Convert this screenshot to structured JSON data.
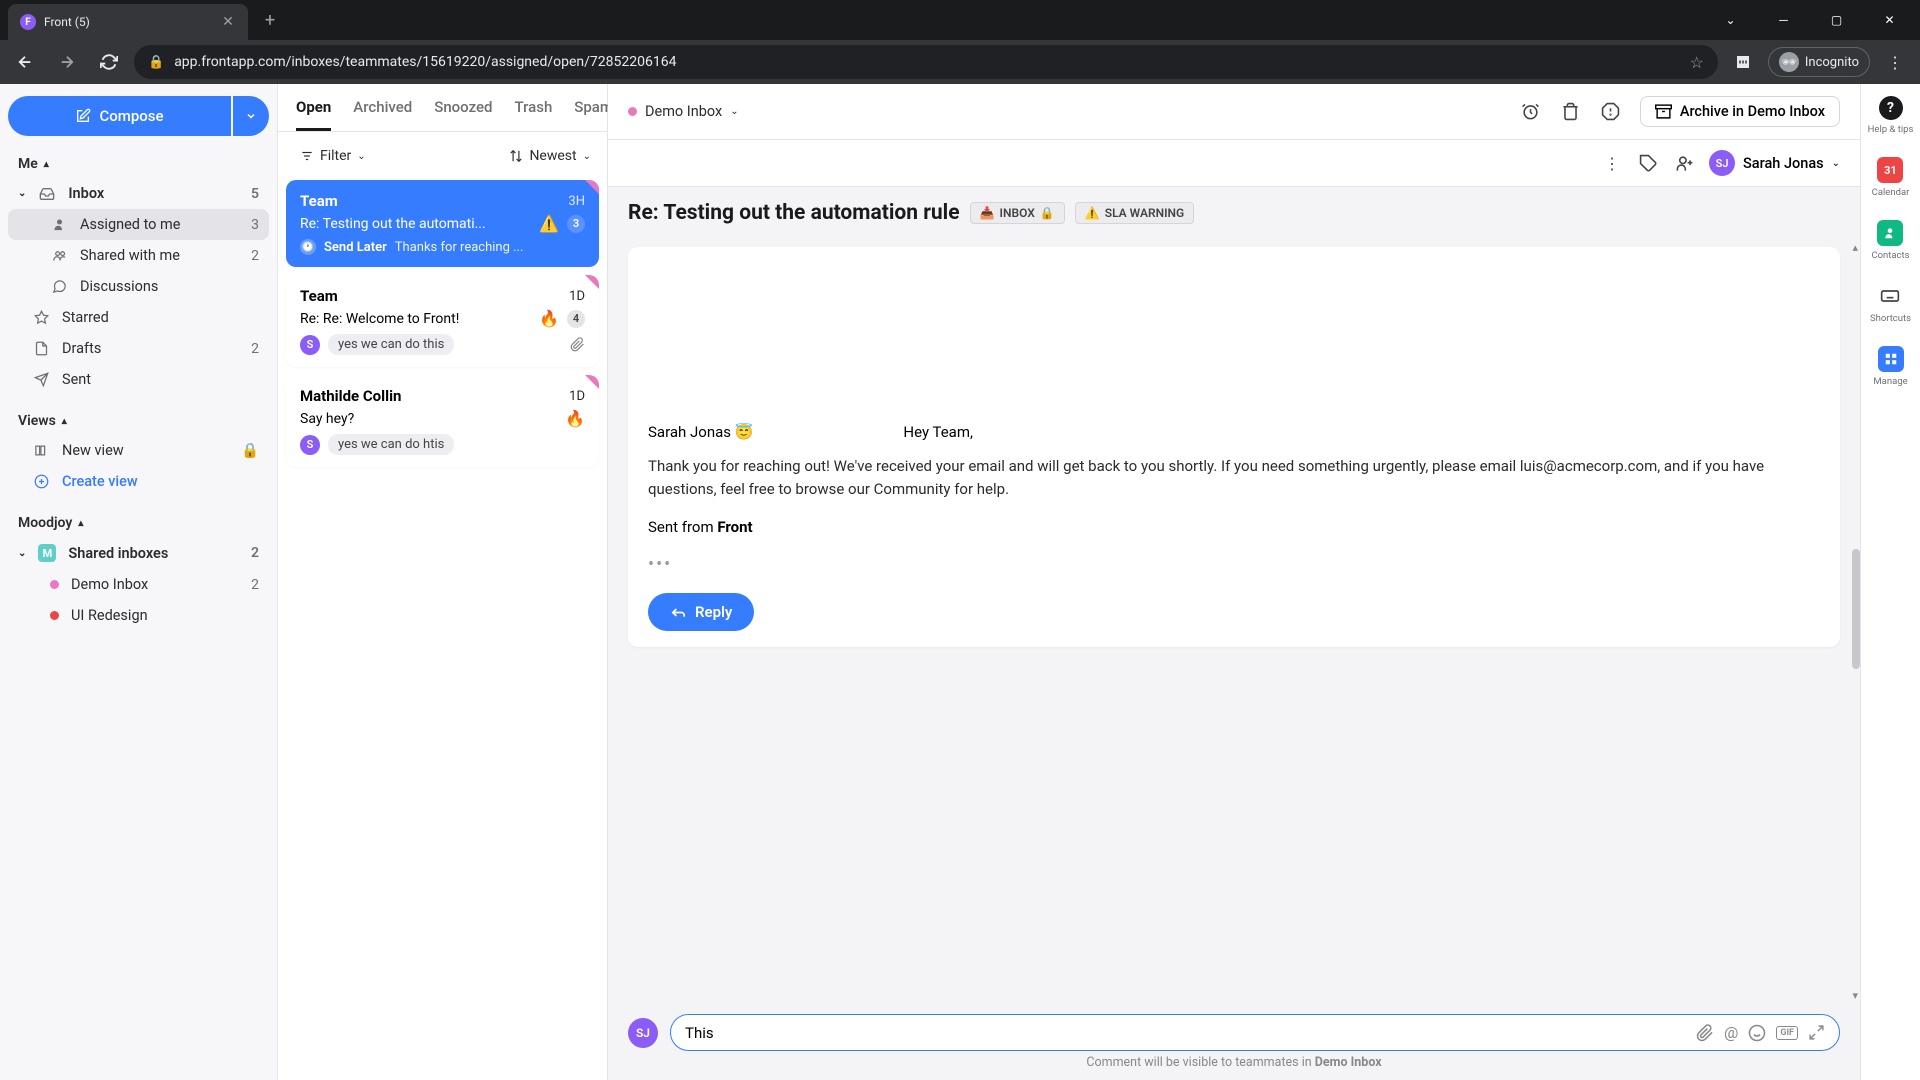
{
  "browser": {
    "tab_title": "Front (5)",
    "url": "app.frontapp.com/inboxes/teammates/15619220/assigned/open/72852206164",
    "incognito_label": "Incognito"
  },
  "sidebar": {
    "compose_label": "Compose",
    "sections": {
      "me": {
        "title": "Me"
      },
      "views": {
        "title": "Views"
      },
      "moodjoy": {
        "title": "Moodjoy"
      }
    },
    "inbox": {
      "label": "Inbox",
      "count": "5"
    },
    "assigned": {
      "label": "Assigned to me",
      "count": "3"
    },
    "shared_with_me": {
      "label": "Shared with me",
      "count": "2"
    },
    "discussions": {
      "label": "Discussions"
    },
    "starred": {
      "label": "Starred"
    },
    "drafts": {
      "label": "Drafts",
      "count": "2"
    },
    "sent": {
      "label": "Sent"
    },
    "new_view": {
      "label": "New view"
    },
    "create_view": {
      "label": "Create view"
    },
    "shared_inboxes": {
      "label": "Shared inboxes",
      "count": "2"
    },
    "demo_inbox": {
      "label": "Demo Inbox",
      "count": "2"
    },
    "ui_redesign": {
      "label": "UI Redesign"
    }
  },
  "convo_tabs": {
    "open": "Open",
    "archived": "Archived",
    "snoozed": "Snoozed",
    "trash": "Trash",
    "spam": "Spam"
  },
  "convo_toolbar": {
    "filter": "Filter",
    "sort": "Newest"
  },
  "convos": [
    {
      "sender": "Team",
      "time": "3H",
      "subject": "Re: Testing out the automati...",
      "warn_icon": "⚠️",
      "count": "3",
      "send_later_label": "Send Later",
      "preview": "Thanks for reaching ..."
    },
    {
      "sender": "Team",
      "time": "1D",
      "subject": "Re: Re: Welcome to Front!",
      "fire_icon": "🔥",
      "count": "4",
      "avatar": "S",
      "chip": "yes we can do this"
    },
    {
      "sender": "Mathilde Collin",
      "time": "1D",
      "subject": "Say hey?",
      "fire_icon": "🔥",
      "avatar": "S",
      "chip": "yes we can do htis"
    }
  ],
  "main": {
    "inbox_chip": "Demo Inbox",
    "archive_btn": "Archive in Demo Inbox",
    "assignee_name": "Sarah Jonas",
    "assignee_initials": "SJ",
    "subject": "Re: Testing out the automation rule",
    "pill_inbox": "INBOX",
    "pill_sla": "SLA WARNING",
    "msg_from": "Sarah Jonas 😇",
    "msg_greet": "Hey Team,",
    "msg_body": "Thank you for reaching out! We've received your email and will get back to you shortly. If you need something urgently, please email luis@acmecorp.com, and if you have questions, feel free to browse our Community for help.",
    "msg_sent_prefix": "Sent from ",
    "msg_sent_app": "Front",
    "reply_btn": "Reply",
    "comment_avatar": "SJ",
    "comment_value": "This",
    "comment_hint_prefix": "Comment will be visible to teammates in ",
    "comment_hint_inbox": "Demo Inbox"
  },
  "rail": {
    "help_tips": "Help & tips",
    "calendar": "Calendar",
    "contacts": "Contacts",
    "shortcuts": "Shortcuts",
    "manage": "Manage"
  }
}
